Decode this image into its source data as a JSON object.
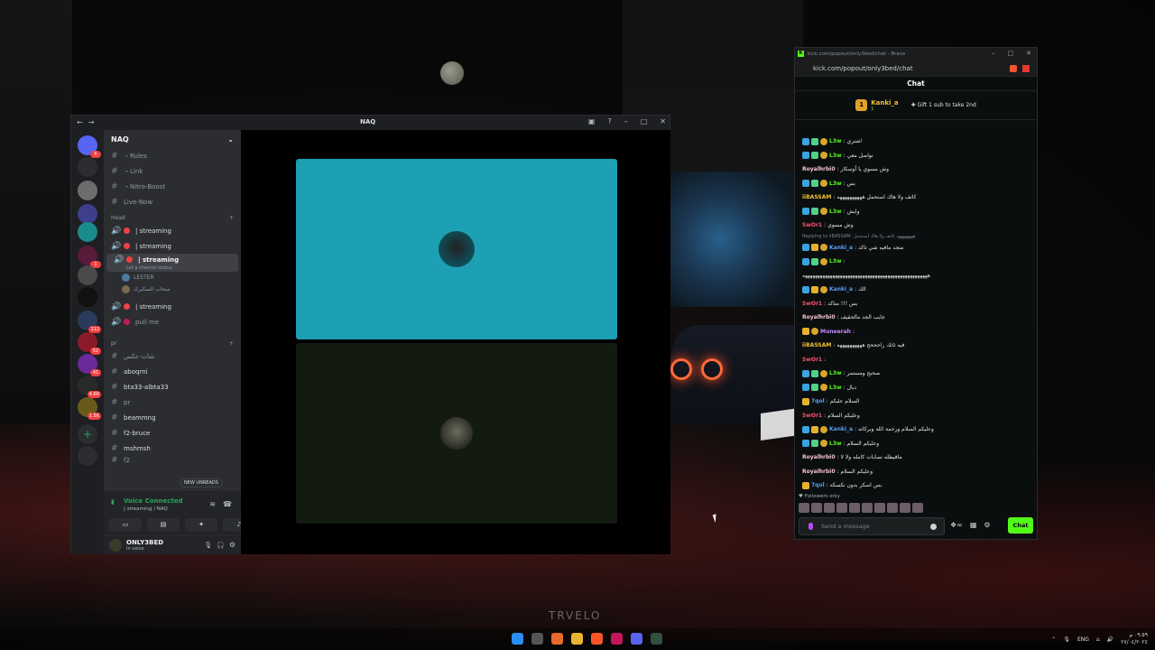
{
  "discord": {
    "title": "NAQ",
    "server_name": "NAQ",
    "server_badges": [
      "6",
      "",
      "",
      "1",
      "",
      "",
      "112",
      "52",
      "41",
      "4.6K",
      "1.5K"
    ],
    "top_channels": [
      {
        "label": "・Rules",
        "icon": "rules-icon"
      },
      {
        "label": "・Link",
        "icon": "hash-icon"
      },
      {
        "label": "・Nitro-Boost",
        "icon": "hash-icon"
      },
      {
        "label": "Live-Now",
        "icon": "hash-icon"
      }
    ],
    "category_head": "Head",
    "voice_channels": [
      {
        "label": "| streaming",
        "active": false
      },
      {
        "label": "| streaming",
        "active": false
      },
      {
        "label": "| streaming",
        "active": true,
        "status": "Let a channel status"
      }
    ],
    "voice_users": [
      "LESTER",
      "سحاب السكبرك"
    ],
    "voice_channels_2": [
      {
        "label": "| streaming"
      },
      {
        "label": "pull me"
      }
    ],
    "category_pr": "pr",
    "text_channels": [
      "شات-عكس",
      "aboqrni",
      "bta33-albta33",
      "pr",
      "beammng",
      "f2-bruce",
      "mshmsh",
      "f2"
    ],
    "new_unreads": "NEW UNREADS",
    "voice_connected": "Voice Connected",
    "voice_location": "| streaming / NAQ",
    "username": "ONLY3BED",
    "user_status": "In voice"
  },
  "kick": {
    "tab_title": "kick.com/popout/only3bed/chat - Brave",
    "url": "kick.com/popout/only3bed/chat",
    "header": "Chat",
    "pinned_rank": "1",
    "pinned_name": "Kanki_a",
    "pinned_sub": "1",
    "gift_text": "Gift 1 sub to take 2nd",
    "messages": [
      {
        "badges": "acd",
        "name": "L3w",
        "color": "#53fc18",
        "text": "اشتري"
      },
      {
        "badges": "acd",
        "name": "L3w",
        "color": "#53fc18",
        "text": "تواصل معي"
      },
      {
        "badges": "",
        "name": "Royalhrbi0",
        "color": "#f5c4d6",
        "text": "وش مسوي يا أوسكار"
      },
      {
        "badges": "acd",
        "name": "L3w",
        "color": "#53fc18",
        "text": "بس"
      },
      {
        "badges": "",
        "name": "iiBASSAM",
        "color": "#f1c232",
        "text": "كاتف ولا هاك استحمل ههههههههههه"
      },
      {
        "badges": "acd",
        "name": "L3w",
        "color": "#53fc18",
        "text": "وايش"
      },
      {
        "badges": "",
        "name": "SwOr1",
        "color": "#ff4f6d",
        "text": "وش مسوي"
      },
      {
        "reply": "Replying to iiBASSAM: ههههههههه كاتف ولا هاك استحمل"
      },
      {
        "badges": "aed",
        "name": "Kanki_a",
        "color": "#5a9ef7",
        "text": "متجد مافيه شي تاكد"
      },
      {
        "badges": "acd",
        "name": "L3w",
        "color": "#53fc18",
        "text": ""
      },
      {
        "badges": "",
        "name": "",
        "color": "#e8e8e8",
        "text": "ههههههههههههههههههههههههههههههههههههههههههههههههههه"
      },
      {
        "badges": "aed",
        "name": "Kanki_a",
        "color": "#5a9ef7",
        "text": "الك"
      },
      {
        "badges": "",
        "name": "SwOr1",
        "color": "#ff4f6d",
        "text": "بس !!! متاكد"
      },
      {
        "badges": "",
        "name": "Royalhrbi0",
        "color": "#f5c4d6",
        "text": "جايب الجد مالحقيف"
      },
      {
        "badges": "ed",
        "name": "Muneerah",
        "color": "#c58af9",
        "text": ""
      },
      {
        "badges": "",
        "name": "iiBASSAM",
        "color": "#f1c232",
        "text": "فيه ثانك راحححح ههههههههههه"
      },
      {
        "badges": "",
        "name": "SwOr1",
        "color": "#ff4f6d",
        "text": ""
      },
      {
        "badges": "acd",
        "name": "L3w",
        "color": "#53fc18",
        "text": "صحيح ومستمر"
      },
      {
        "badges": "acd",
        "name": "L3w",
        "color": "#53fc18",
        "text": "دبال"
      },
      {
        "badges": "e",
        "name": "7qol",
        "color": "#5a9ef7",
        "text": "السلام عليكم"
      },
      {
        "badges": "",
        "name": "SwOr1",
        "color": "#ff4f6d",
        "text": "وعليكم السلام"
      },
      {
        "badges": "aed",
        "name": "Kanki_a",
        "color": "#5a9ef7",
        "text": "وعليكم السلام ورحمة الله وبركاته"
      },
      {
        "badges": "acd",
        "name": "L3w",
        "color": "#53fc18",
        "text": "وعليكم السلام"
      },
      {
        "badges": "",
        "name": "Royalhrbi0",
        "color": "#f5c4d6",
        "text": "ماقيطله نصابات كامله ولا لا"
      },
      {
        "badges": "",
        "name": "Royalhrbi0",
        "color": "#f5c4d6",
        "text": "وعليكم السلام"
      },
      {
        "badges": "e",
        "name": "7qol",
        "color": "#5a9ef7",
        "text": "بس اسكر بدون نكسكه"
      }
    ],
    "followers_only": "Followers only",
    "input_placeholder": "Send a message",
    "send_label": "Chat"
  },
  "desktop": {
    "watermark": "TRVELO",
    "lang": "ENG",
    "time": "٠٩:٥٩ م",
    "date": "٢٧/٠٤/٢٠٢٤"
  }
}
